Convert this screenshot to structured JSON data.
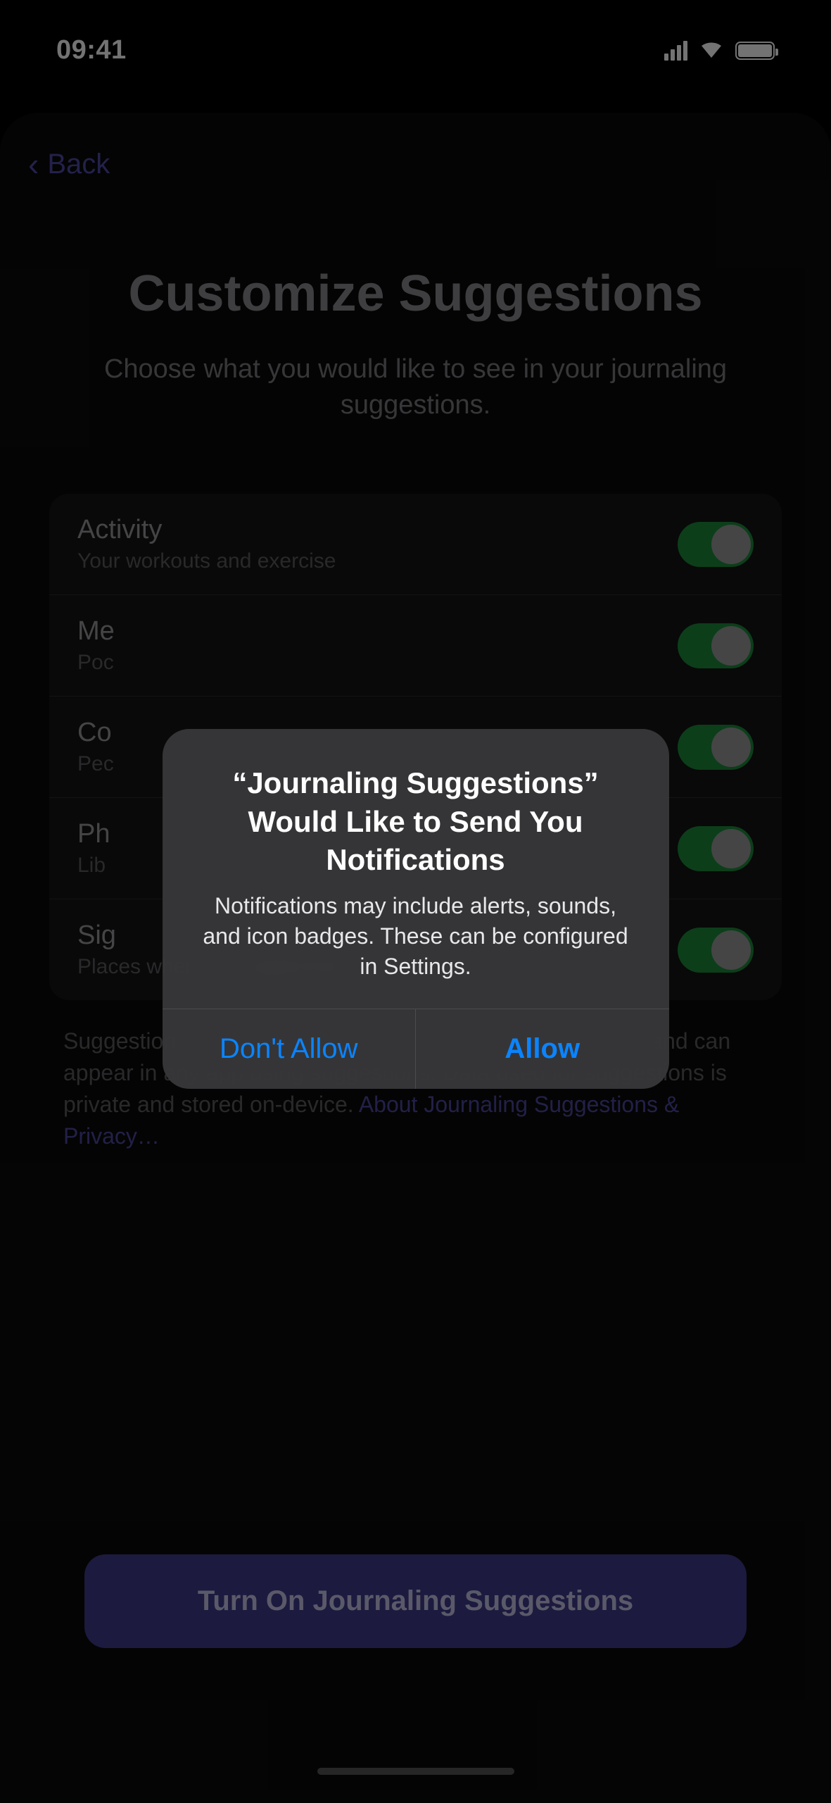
{
  "status": {
    "time": "09:41"
  },
  "nav": {
    "back": "Back"
  },
  "header": {
    "title": "Customize Suggestions",
    "subtitle": "Choose what you would like to see in your journaling suggestions."
  },
  "rows": [
    {
      "title": "Activity",
      "sub": "Your workouts and exercise",
      "on": true
    },
    {
      "title": "Me",
      "sub": "Poc",
      "on": true
    },
    {
      "title": "Co",
      "sub": "Pec",
      "on": true
    },
    {
      "title": "Ph",
      "sub": "Lib",
      "on": true
    },
    {
      "title": "Sig",
      "sub": "Places where you spend time",
      "on": true
    }
  ],
  "footer": {
    "note": "Suggestions use data from apps and services you turn on, and can appear in any app using suggestions. Data used for suggestions is private and stored on-device. ",
    "link": "About Journaling Suggestions & Privacy…"
  },
  "cta": {
    "label": "Turn On Journaling Suggestions"
  },
  "alert": {
    "title": "“Journaling Suggestions” Would Like to Send You Notifications",
    "message": "Notifications may include alerts, sounds, and icon badges. These can be configured in Settings.",
    "deny": "Don't Allow",
    "allow": "Allow"
  }
}
